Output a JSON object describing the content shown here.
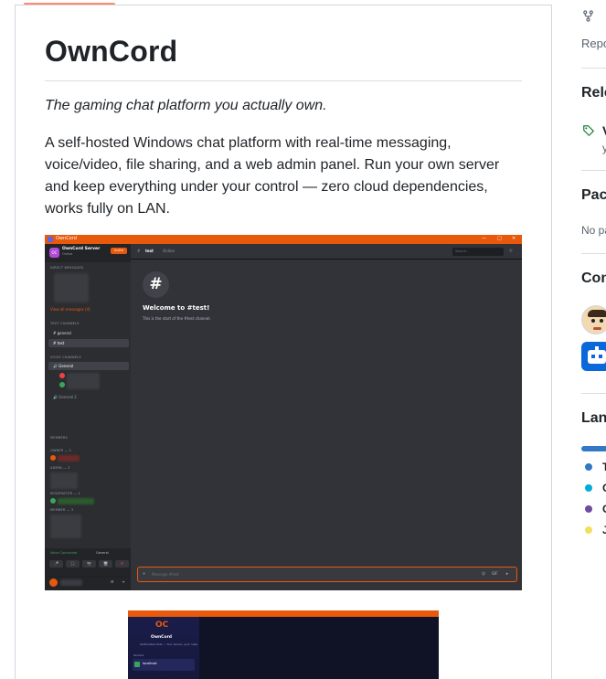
{
  "readme": {
    "title": "OwnCord",
    "tagline": "The gaming chat platform you actually own.",
    "description": "A self-hosted Windows chat platform with real-time messaging, voice/video, file sharing, and a web admin panel. Run your own server and keep everything under your control — zero cloud dependencies, works fully on LAN."
  },
  "screenshot1": {
    "window_title": "OwnCord",
    "server_name": "OwnCord Server",
    "server_status": "Online",
    "invite_label": "Invite",
    "section_dm": "Direct Messages",
    "view_all": "View all messages (4)",
    "section_text": "Text Channels",
    "text_channels": [
      "general",
      "test"
    ],
    "section_voice": "Voice Channels",
    "voice_channels": [
      "General",
      "General 2"
    ],
    "section_members": "Members",
    "member_groups": [
      "OWNER — 1",
      "ADMIN — 3",
      "MODERATOR — 1",
      "MEMBER — 3"
    ],
    "voice_connected": "Voice Connected",
    "voice_channel_current": "General",
    "channel_name": "test",
    "channel_status": "Online",
    "search_placeholder": "Search...",
    "welcome_title": "Welcome to #test!",
    "welcome_sub": "This is the start of the #test channel.",
    "input_placeholder": "Message #test",
    "hash": "#",
    "gif": "GIF"
  },
  "screenshot2": {
    "logo": "OC",
    "name": "OwnCord",
    "subtitle": "Self-hosted chat — Your server, your rules",
    "servers_label": "Servers",
    "server_card": "localhost"
  },
  "sidebar": {
    "repo_text": "Repo",
    "releases_heading": "Rele",
    "release_text": "V",
    "release_sub": "y",
    "packages_heading": "Pac",
    "packages_text": "No pa",
    "contributors_heading": "Con",
    "languages_heading": "Lan",
    "languages": [
      {
        "name": "T",
        "color": "#3178c6"
      },
      {
        "name": "C",
        "color": "#00add8"
      },
      {
        "name": "C",
        "color": "#6e4c9e"
      },
      {
        "name": "J",
        "color": "#f1e05a"
      }
    ]
  }
}
